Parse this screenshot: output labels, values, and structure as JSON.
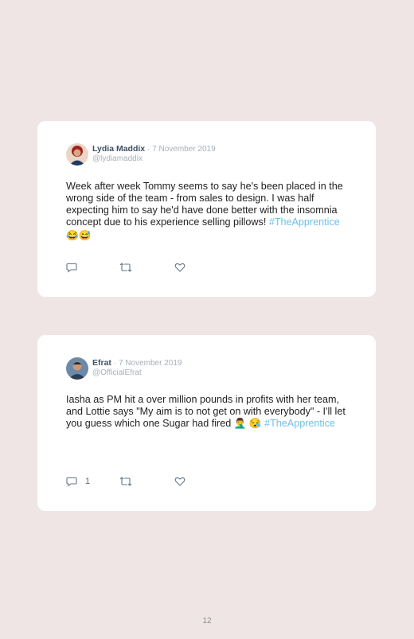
{
  "tweets": [
    {
      "display_name": "Lydia Maddix",
      "date": "· 7 November 2019",
      "handle": "@lydiamaddix",
      "text": "Week after week Tommy seems to say he's been placed in the wrong side of the team - from sales to design. I was half expecting him to say he'd have done better with the insomnia concept due to his experience selling pillows! ",
      "hashtag": "#TheApprentice",
      "emojis": "😂😅",
      "reply_count": "",
      "avatar_colors": [
        "#c0392b",
        "#1f3a5f"
      ]
    },
    {
      "display_name": "Efrat",
      "date": "· 7 November 2019",
      "handle": "@OfficialEfrat",
      "text": "Iasha as PM hit a over million pounds in profits with her team, and Lottie says \"My aim is to not get on with everybody\" - I'll let you guess which one Sugar had fired 🤦‍♂️ 😪 ",
      "hashtag": "#TheApprentice",
      "emojis": "",
      "reply_count": "1",
      "avatar_colors": [
        "#2c3e50",
        "#5d7a96"
      ]
    }
  ],
  "icons": {
    "reply": "reply-icon",
    "retweet": "retweet-icon",
    "like": "heart-icon"
  },
  "colors": {
    "background": "#f0e5e5",
    "card": "#ffffff",
    "hashtag": "#6fc0e6",
    "name": "#3e5164",
    "muted": "#a7b0b9"
  },
  "page_number": "12"
}
